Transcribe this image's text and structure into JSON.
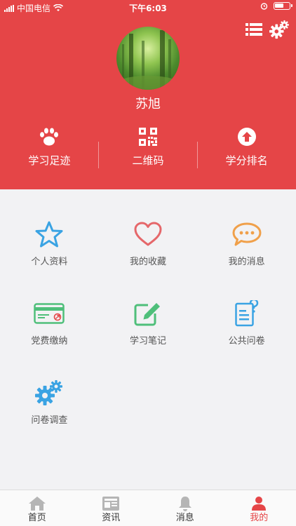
{
  "status_bar": {
    "carrier": "中国电信",
    "time": "下午6:03"
  },
  "profile": {
    "name": "苏旭"
  },
  "quick_actions": [
    {
      "label": "学习足迹",
      "icon": "paw-icon"
    },
    {
      "label": "二维码",
      "icon": "qrcode-icon"
    },
    {
      "label": "学分排名",
      "icon": "arrow-up-circle-icon"
    }
  ],
  "grid_items": [
    {
      "label": "个人资料",
      "icon": "star-icon",
      "color": "#3aa3e3"
    },
    {
      "label": "我的收藏",
      "icon": "heart-icon",
      "color": "#e5676a"
    },
    {
      "label": "我的消息",
      "icon": "chat-bubble-icon",
      "color": "#f0a04a"
    },
    {
      "label": "党费缴纳",
      "icon": "card-icon",
      "color": "#4fbf7a"
    },
    {
      "label": "学习笔记",
      "icon": "edit-icon",
      "color": "#4fbf7a"
    },
    {
      "label": "公共问卷",
      "icon": "survey-icon",
      "color": "#3aa3e3"
    },
    {
      "label": "问卷调查",
      "icon": "gears-icon",
      "color": "#3aa3e3"
    }
  ],
  "tabs": [
    {
      "label": "首页",
      "icon": "home-icon"
    },
    {
      "label": "资讯",
      "icon": "news-icon"
    },
    {
      "label": "消息",
      "icon": "bell-icon"
    },
    {
      "label": "我的",
      "icon": "person-icon",
      "active": true
    }
  ],
  "colors": {
    "primary": "#e54547",
    "background": "#f2f2f4",
    "tab_inactive_icon": "#b5b5b5"
  }
}
